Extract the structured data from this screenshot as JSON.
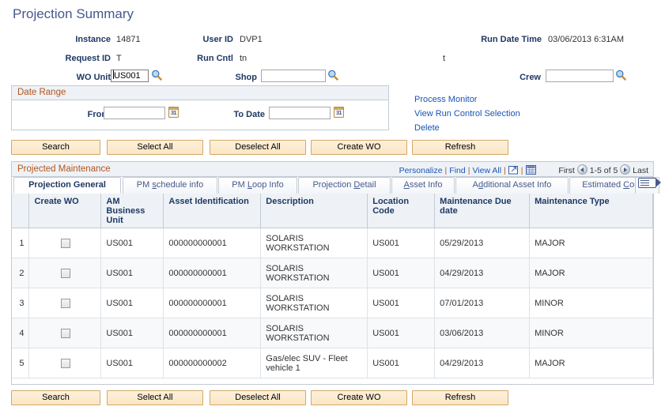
{
  "page": {
    "title": "Projection Summary"
  },
  "header": {
    "instance_label": "Instance",
    "instance_value": "14871",
    "request_id_label": "Request ID",
    "request_id_value": "T",
    "wo_unit_label": "WO Unit",
    "wo_unit_value": "US001",
    "user_id_label": "User ID",
    "user_id_value": "DVP1",
    "run_cntl_label": "Run Cntl",
    "run_cntl_value": "tn",
    "shop_label": "Shop",
    "shop_value": "",
    "stray_text": "t",
    "run_date_time_label": "Run Date Time",
    "run_date_time_value": "03/06/2013  6:31AM",
    "crew_label": "Crew",
    "crew_value": ""
  },
  "date_range": {
    "group_title": "Date Range",
    "from_label": "From Date",
    "from_value": "",
    "to_label": "To Date",
    "to_value": "",
    "calendar_day": "31"
  },
  "links": [
    {
      "label": "Process Monitor"
    },
    {
      "label": "View Run Control Selection"
    },
    {
      "label": "Delete"
    }
  ],
  "action_buttons": [
    {
      "label": "Search"
    },
    {
      "label": "Select All"
    },
    {
      "label": "Deselect All"
    },
    {
      "label": "Create WO"
    },
    {
      "label": "Refresh"
    }
  ],
  "grid": {
    "title": "Projected Maintenance",
    "toolbar": {
      "personalize": "Personalize",
      "find": "Find",
      "view_all": "View All",
      "separator": "|",
      "expand_icon": "expand-window-icon",
      "grid_icon": "download-to-spreadsheet-icon"
    },
    "pager": {
      "first": "First",
      "range": "1-5 of 5",
      "last": "Last",
      "prev_icon": "previous-arrow-icon",
      "next_icon": "next-arrow-icon"
    },
    "tabs": [
      {
        "label": "Projection General",
        "accel": "",
        "active": true
      },
      {
        "label": "PM schedule info",
        "accel": "s",
        "active": false
      },
      {
        "label": "PM Loop Info",
        "accel": "L",
        "active": false
      },
      {
        "label": "Projection Detail",
        "accel": "D",
        "active": false
      },
      {
        "label": "Asset Info",
        "accel": "A",
        "active": false
      },
      {
        "label": "Additional Asset Info",
        "accel": "d",
        "active": false
      },
      {
        "label": "Estimated Cost",
        "accel": "C",
        "active": false
      },
      {
        "label": "",
        "accel": "",
        "active": false,
        "icon": "show-next-tabs-icon"
      }
    ],
    "columns": [
      "",
      "Create WO",
      "AM Business Unit",
      "Asset Identification",
      "Description",
      "Location Code",
      "Maintenance Due date",
      "Maintenance Type"
    ],
    "rows": [
      {
        "index": "1",
        "checked": false,
        "am_bu": "US001",
        "asset_id": "000000000001",
        "description": "SOLARIS WORKSTATION",
        "location": "US001",
        "due_date": "05/29/2013",
        "type": "MAJOR"
      },
      {
        "index": "2",
        "checked": false,
        "am_bu": "US001",
        "asset_id": "000000000001",
        "description": "SOLARIS WORKSTATION",
        "location": "US001",
        "due_date": "04/29/2013",
        "type": "MAJOR"
      },
      {
        "index": "3",
        "checked": false,
        "am_bu": "US001",
        "asset_id": "000000000001",
        "description": "SOLARIS WORKSTATION",
        "location": "US001",
        "due_date": "07/01/2013",
        "type": "MINOR"
      },
      {
        "index": "4",
        "checked": false,
        "am_bu": "US001",
        "asset_id": "000000000001",
        "description": "SOLARIS WORKSTATION",
        "location": "US001",
        "due_date": "03/06/2013",
        "type": "MINOR"
      },
      {
        "index": "5",
        "checked": false,
        "am_bu": "US001",
        "asset_id": "000000000002",
        "description": "Gas/elec SUV - Fleet vehicle 1",
        "location": "US001",
        "due_date": "04/29/2013",
        "type": "MAJOR"
      }
    ]
  },
  "bottom_buttons": [
    {
      "label": "Search"
    },
    {
      "label": "Select All"
    },
    {
      "label": "Deselect All"
    },
    {
      "label": "Create WO"
    },
    {
      "label": "Refresh"
    }
  ],
  "colors": {
    "title": "#46598c",
    "label": "#1f3864",
    "link": "#1a55b5",
    "group_header_text": "#b4551c",
    "group_header_bg": "#eef2f6",
    "button_bg": "#fbe6c4",
    "button_border": "#d2a96a",
    "grid_border": "#c3cbd3"
  }
}
